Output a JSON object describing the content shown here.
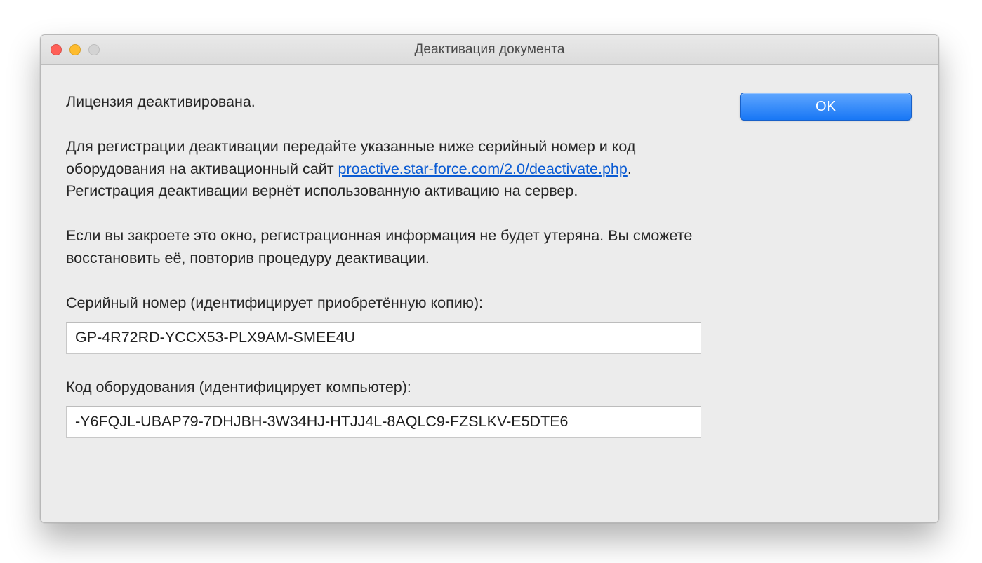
{
  "window": {
    "title": "Деактивация документа"
  },
  "buttons": {
    "ok": "OK"
  },
  "body": {
    "p1": "Лицензия деактивирована.",
    "p2a": "Для регистрации деактивации передайте указанные ниже серийный номер и код оборудования на активационный сайт ",
    "link": "proactive.star-force.com/2.0/deactivate.php",
    "p2b": ". Регистрация деактивации вернёт использованную активацию на сервер.",
    "p3": "Если вы закроете это окно, регистрационная информация не будет утеряна. Вы сможете восстановить её, повторив процедуру деактивации."
  },
  "fields": {
    "serial_label": "Серийный номер (идентифицирует приобретённую копию):",
    "serial_value": "GP-4R72RD-YCCX53-PLX9AM-SMEE4U",
    "hw_label": "Код оборудования (идентифицирует компьютер):",
    "hw_value": "-Y6FQJL-UBAP79-7DHJBH-3W34HJ-HTJJ4L-8AQLC9-FZSLKV-E5DTE6"
  }
}
